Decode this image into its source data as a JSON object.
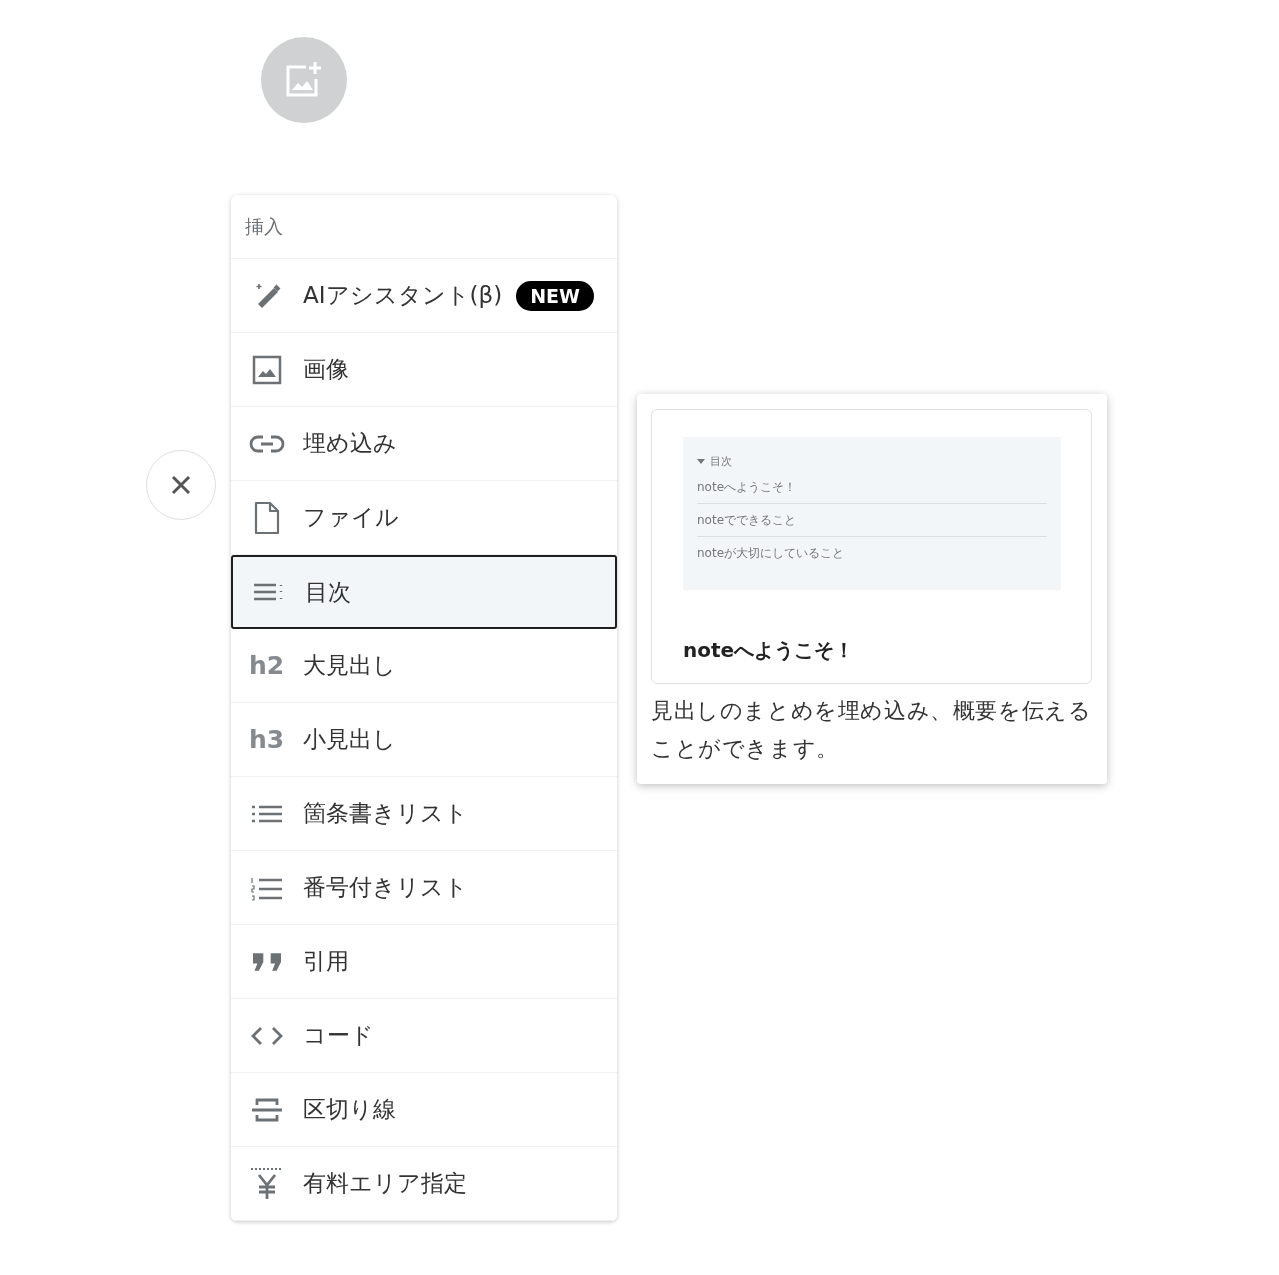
{
  "menu": {
    "header": "挿入",
    "items": [
      {
        "kind": "wand",
        "label": "AIアシスタント(β)",
        "badge": "NEW",
        "selected": false
      },
      {
        "kind": "image",
        "label": "画像",
        "selected": false
      },
      {
        "kind": "link",
        "label": "埋め込み",
        "selected": false
      },
      {
        "kind": "file",
        "label": "ファイル",
        "selected": false
      },
      {
        "kind": "toc",
        "label": "目次",
        "selected": true
      },
      {
        "kind": "heading",
        "icon_text": "h2",
        "label": "大見出し",
        "selected": false
      },
      {
        "kind": "heading",
        "icon_text": "h3",
        "label": "小見出し",
        "selected": false
      },
      {
        "kind": "bullets",
        "label": "箇条書きリスト",
        "selected": false
      },
      {
        "kind": "numbers",
        "label": "番号付きリスト",
        "selected": false
      },
      {
        "kind": "quote",
        "label": "引用",
        "selected": false
      },
      {
        "kind": "code",
        "label": "コード",
        "selected": false
      },
      {
        "kind": "divider",
        "label": "区切り線",
        "selected": false
      },
      {
        "kind": "paid",
        "label": "有料エリア指定",
        "selected": false
      }
    ]
  },
  "preview": {
    "toc_title": "目次",
    "toc_items": [
      "noteへようこそ！",
      "noteでできること",
      "noteが大切にしていること"
    ],
    "heading": "noteへようこそ！",
    "description": "見出しのまとめを埋め込み、概要を伝えることができます。"
  }
}
